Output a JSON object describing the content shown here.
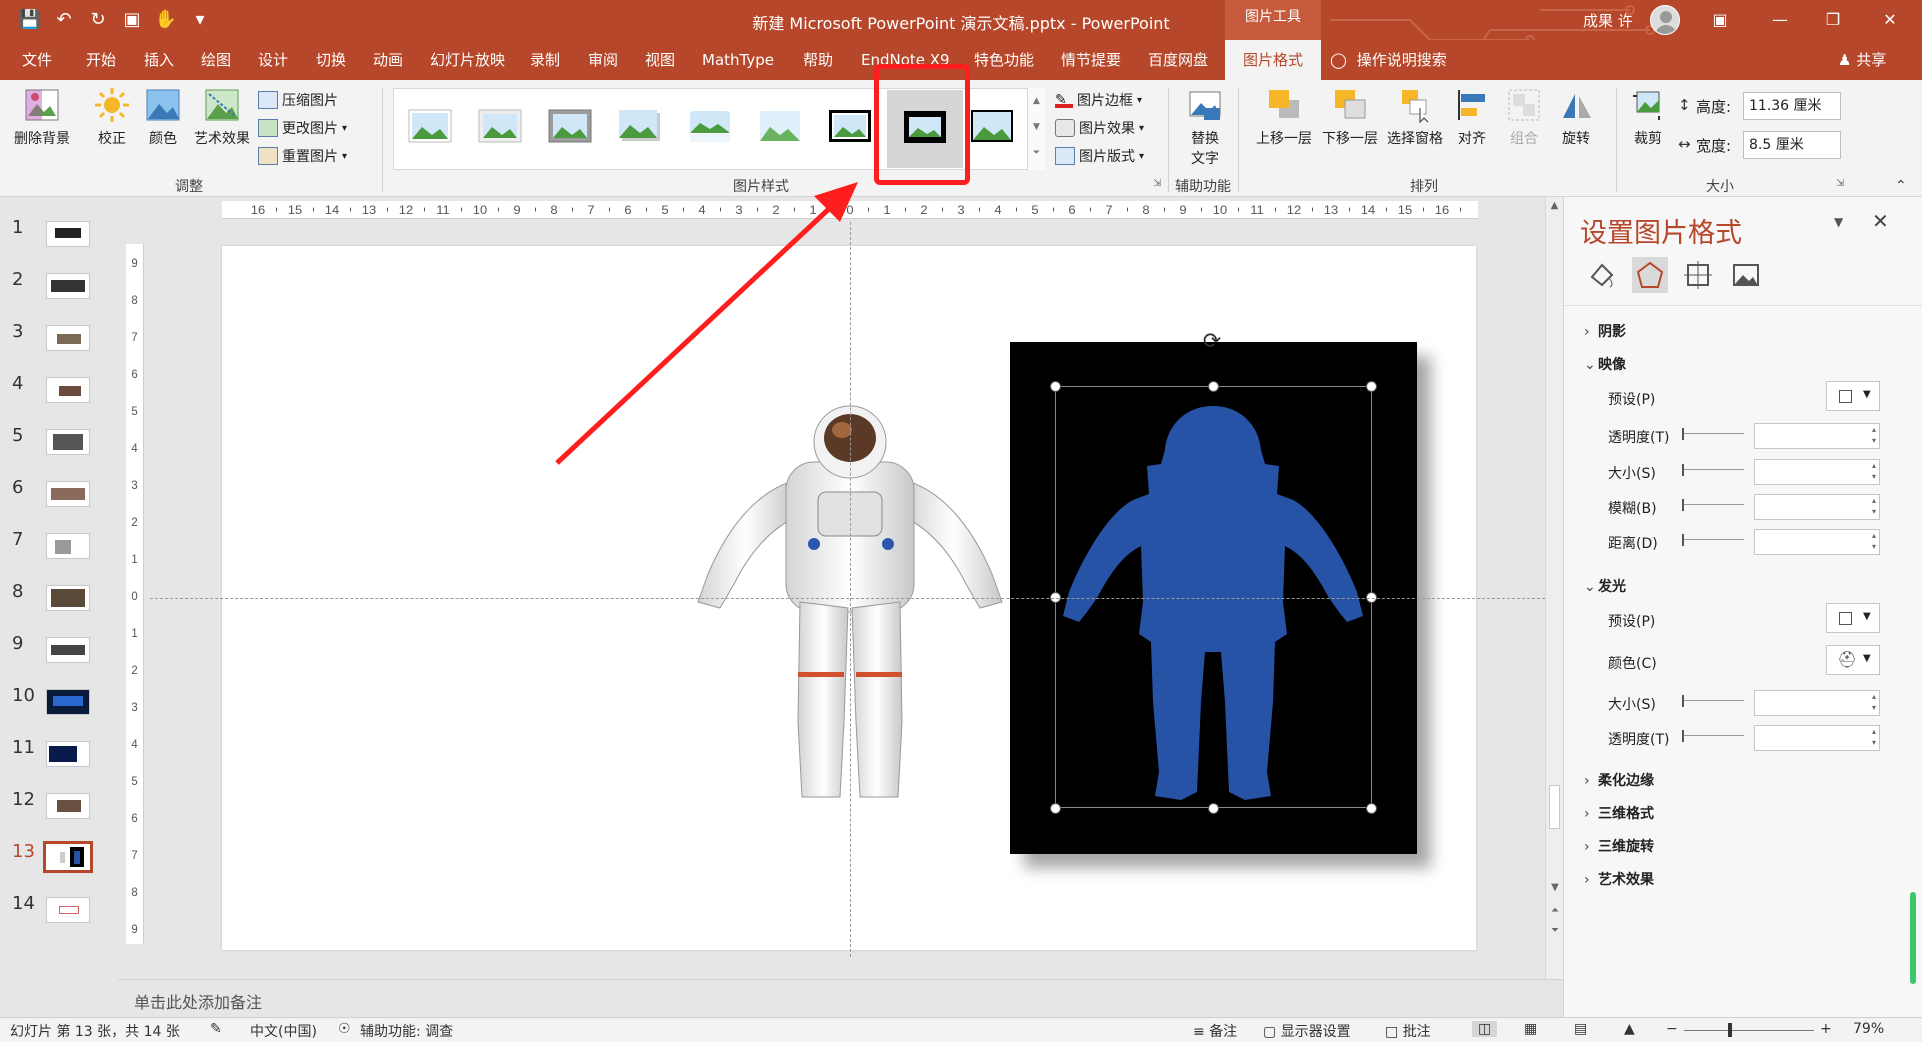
{
  "window": {
    "title": "新建 Microsoft PowerPoint 演示文稿.pptx  -  PowerPoint",
    "context_tab_group": "图片工具",
    "user": "成果 许"
  },
  "tabs": [
    "文件",
    "开始",
    "插入",
    "绘图",
    "设计",
    "切换",
    "动画",
    "幻灯片放映",
    "录制",
    "审阅",
    "视图",
    "MathType",
    "帮助",
    "EndNote X9",
    "特色功能",
    "情节提要",
    "百度网盘"
  ],
  "active_tab": "图片格式",
  "tell_me": "操作说明搜索",
  "share": "共享",
  "ribbon": {
    "adjust": {
      "group_label": "调整",
      "remove_bg": "删除背景",
      "corrections": "校正",
      "color": "颜色",
      "artistic": "艺术效果",
      "compress": "压缩图片",
      "change": "更改图片",
      "reset": "重置图片"
    },
    "styles": {
      "group_label": "图片样式",
      "border": "图片边框",
      "effects": "图片效果",
      "layout": "图片版式"
    },
    "accessibility": {
      "group_label": "辅助功能",
      "alt_text_line1": "替换",
      "alt_text_line2": "文字"
    },
    "arrange": {
      "group_label": "排列",
      "bring_forward": "上移一层",
      "send_backward": "下移一层",
      "selection_pane": "选择窗格",
      "align": "对齐",
      "group": "组合",
      "rotate": "旋转"
    },
    "size": {
      "group_label": "大小",
      "crop": "裁剪",
      "height_label": "高度:",
      "height_value": "11.36 厘米",
      "width_label": "宽度:",
      "width_value": "8.5 厘米"
    }
  },
  "slides": {
    "numbers": [
      "1",
      "2",
      "3",
      "4",
      "5",
      "6",
      "7",
      "8",
      "9",
      "10",
      "11",
      "12",
      "13",
      "14"
    ],
    "current": 13
  },
  "notes_placeholder": "单击此处添加备注",
  "format_pane": {
    "title": "设置图片格式",
    "sections": {
      "shadow": "阴影",
      "reflection": "映像",
      "glow": "发光",
      "soft_edges": "柔化边缘",
      "format_3d": "三维格式",
      "rotation_3d": "三维旋转",
      "artistic": "艺术效果"
    },
    "reflection_props": {
      "preset": "预设(P)",
      "transparency": "透明度(T)",
      "size": "大小(S)",
      "blur": "模糊(B)",
      "distance": "距离(D)"
    },
    "glow_props": {
      "preset": "预设(P)",
      "color": "颜色(C)",
      "size": "大小(S)",
      "transparency": "透明度(T)"
    }
  },
  "status": {
    "slide_info": "幻灯片 第 13 张，共 14 张",
    "language": "中文(中国)",
    "accessibility": "辅助功能: 调查",
    "notes": "备注",
    "display_settings": "显示器设置",
    "comments": "批注",
    "zoom": "79%"
  },
  "colors": {
    "accent": "#b7472a",
    "highlight": "#ff1e1e",
    "silhouette": "#2653a6"
  }
}
